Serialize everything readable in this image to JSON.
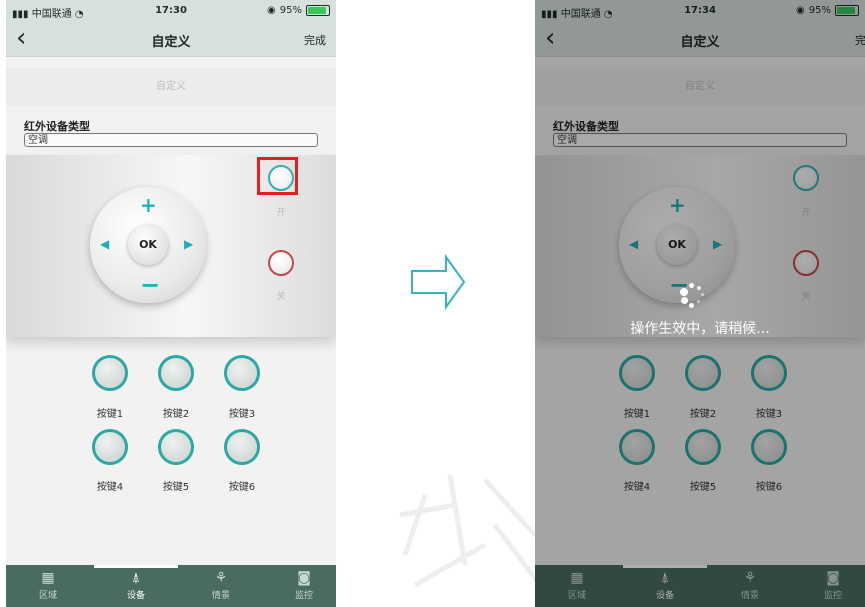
{
  "colors": {
    "accent": "#21b0b5",
    "tabbar": "#4a6b62",
    "highlight": "#e41e1e",
    "off_button": "#c24a4a"
  },
  "left_screen": {
    "status": {
      "carrier": "中国联通",
      "time": "17:30",
      "battery": "95%"
    },
    "nav": {
      "back_icon": "chevron-left-icon",
      "title": "自定义",
      "done": "完成"
    },
    "banner": "自定义",
    "device_type_label": "红外设备类型",
    "device_type_value": "空调",
    "remote": {
      "ok": "OK",
      "on_label": "开",
      "off_label": "关"
    },
    "keys": [
      "按键1",
      "按键2",
      "按键3",
      "按键4",
      "按键5",
      "按键6"
    ],
    "tabs": [
      {
        "label": "区域",
        "icon": "grid-icon"
      },
      {
        "label": "设备",
        "icon": "antenna-icon"
      },
      {
        "label": "情景",
        "icon": "scene-icon"
      },
      {
        "label": "监控",
        "icon": "camera-icon"
      }
    ],
    "active_tab": "设备"
  },
  "right_screen": {
    "status": {
      "carrier": "中国联通",
      "time": "17:34",
      "battery": "95%"
    },
    "nav": {
      "back_icon": "chevron-left-icon",
      "title": "自定义",
      "done": "完成"
    },
    "banner": "自定义",
    "device_type_label": "红外设备类型",
    "device_type_value": "空调",
    "remote": {
      "ok": "OK",
      "on_label": "开",
      "off_label": "关"
    },
    "keys": [
      "按键1",
      "按键2",
      "按键3",
      "按键4",
      "按键5",
      "按键6"
    ],
    "loading_text": "操作生效中，请稍候...",
    "tabs": [
      {
        "label": "区域",
        "icon": "grid-icon"
      },
      {
        "label": "设备",
        "icon": "antenna-icon"
      },
      {
        "label": "情景",
        "icon": "scene-icon"
      },
      {
        "label": "监控",
        "icon": "camera-icon"
      }
    ]
  },
  "transition_icon": "right-arrow-outline-icon"
}
